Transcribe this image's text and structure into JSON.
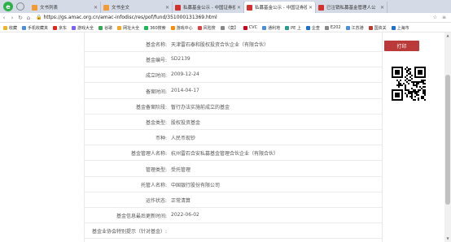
{
  "browser": {
    "tabs": [
      {
        "label": "文书列表",
        "favicon": "orange",
        "active": false
      },
      {
        "label": "文书全文",
        "favicon": "orange",
        "active": false
      },
      {
        "label": "私募基金公示 - 中国证券投",
        "favicon": "red",
        "active": false
      },
      {
        "label": "私募基金公示 - 中国证券投",
        "favicon": "red",
        "active": true
      },
      {
        "label": "已注销私募基金管理人公",
        "favicon": "red",
        "active": false
      }
    ],
    "url": "https://gs.amac.org.cn/amac-infodisc/res/pof/fund/351000131369.html",
    "url_host_prefix": "https://",
    "url_host": "gs.amac.org.cn",
    "url_path": "/amac-infodisc/res/pof/fund/351000131369.html"
  },
  "bookmarks": [
    {
      "label": "收藏",
      "color": "#f0b429"
    },
    {
      "label": "手机收藏夹",
      "color": "#4a90d9"
    },
    {
      "label": "京东",
      "color": "#e1251b"
    },
    {
      "label": "游戏大全",
      "color": "#7b61ff"
    },
    {
      "label": "谷歌",
      "color": "#34a853"
    },
    {
      "label": "网址大全",
      "color": "#f5a623"
    },
    {
      "label": "360搜索",
      "color": "#19b955"
    },
    {
      "label": "游戏中心",
      "color": "#ff8a00"
    },
    {
      "label": "风险搜",
      "color": "#e14040"
    },
    {
      "label": "《莫】",
      "color": "#888888"
    },
    {
      "label": "CVC",
      "color": "#d0021b"
    },
    {
      "label": "通利地",
      "color": "#4a90d9"
    },
    {
      "label": "PE 上",
      "color": "#2a9d8f"
    },
    {
      "label": "企查",
      "color": "#1f6fd1"
    },
    {
      "label": "E202",
      "color": "#888888"
    },
    {
      "label": "江苏港",
      "color": "#4a90d9"
    },
    {
      "label": "国资关",
      "color": "#c0392b"
    },
    {
      "label": "上海市",
      "color": "#1f6fd1"
    }
  ],
  "fund": {
    "rows": [
      {
        "label": "基金名称:",
        "value": "天津雷石泰和股权投资合伙企业（有限合伙）"
      },
      {
        "label": "基金编号:",
        "value": "SD2139"
      },
      {
        "label": "成立时间:",
        "value": "2009-12-24"
      },
      {
        "label": "备案时间:",
        "value": "2014-04-17"
      },
      {
        "label": "基金备案阶段:",
        "value": "暂行办法实施前成立的基金"
      },
      {
        "label": "基金类型:",
        "value": "股权投资基金"
      },
      {
        "label": "币种:",
        "value": "人民币现钞"
      },
      {
        "label": "基金管理人名称:",
        "value": "杭州雷石合安私募基金管理合伙企业（有限合伙）"
      },
      {
        "label": "管理类型:",
        "value": "受托管理"
      },
      {
        "label": "托管人名称:",
        "value": "中国银行股份有限公司"
      },
      {
        "label": "运作状态:",
        "value": "正常清算"
      },
      {
        "label": "基金信息最后更新时间:",
        "value": "2022-06-02"
      },
      {
        "label": "基金业协会特别提示（针对基金）:",
        "value": ""
      }
    ]
  },
  "actions": {
    "print_label": "打印"
  },
  "colors": {
    "print_button": "#b93a38",
    "tab_strip": "#d4dbe6"
  }
}
